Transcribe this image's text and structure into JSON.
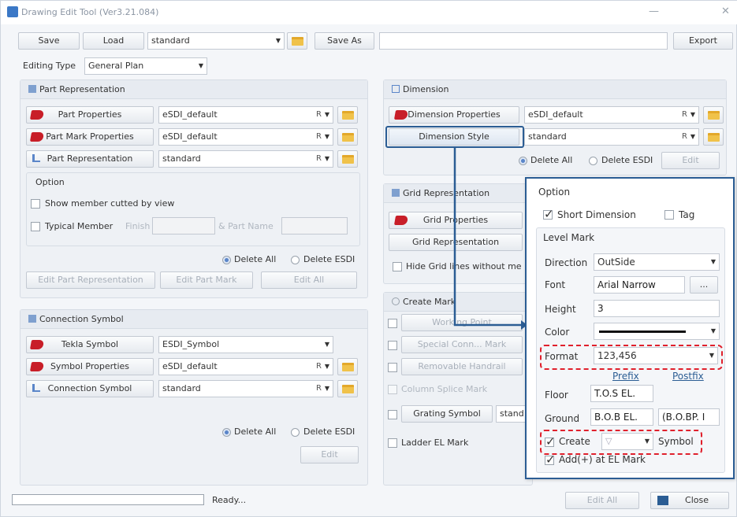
{
  "window": {
    "title": "Drawing Edit Tool (Ver3.21.084)",
    "min": "—",
    "close": "✕"
  },
  "top": {
    "save": "Save",
    "load": "Load",
    "preset": "standard",
    "save_as": "Save As",
    "export": "Export"
  },
  "editing_type": {
    "label": "Editing Type",
    "value": "General Plan"
  },
  "part_rep": {
    "title": "Part Representation",
    "rows": [
      {
        "label": "Part Properties",
        "value": "eSDI_default",
        "r": "R"
      },
      {
        "label": "Part Mark Properties",
        "value": "eSDI_default",
        "r": "R"
      },
      {
        "label": "Part Representation",
        "value": "standard",
        "r": "R"
      }
    ],
    "option": "Option",
    "show_member": "Show member cutted by view",
    "typical_member": "Typical Member",
    "finish": "Finish",
    "part_name": "& Part Name",
    "delete_all": "Delete All",
    "delete_esdi": "Delete ESDI",
    "edit_part_rep": "Edit Part Representation",
    "edit_part_mark": "Edit Part Mark",
    "edit_all": "Edit All"
  },
  "connection": {
    "title": "Connection Symbol",
    "rows": [
      {
        "label": "Tekla Symbol",
        "value": "ESDI_Symbol",
        "r": ""
      },
      {
        "label": "Symbol Properties",
        "value": "eSDI_default",
        "r": "R"
      },
      {
        "label": "Connection Symbol",
        "value": "standard",
        "r": "R"
      }
    ],
    "delete_all": "Delete All",
    "delete_esdi": "Delete ESDI",
    "edit": "Edit"
  },
  "dimension": {
    "title": "Dimension",
    "rows": [
      {
        "label": "Dimension Properties",
        "value": "eSDI_default",
        "r": "R"
      },
      {
        "label": "Dimension Style",
        "value": "standard",
        "r": "R"
      }
    ],
    "delete_all": "Delete All",
    "delete_esdi": "Delete ESDI",
    "edit": "Edit"
  },
  "grid": {
    "title": "Grid Representation",
    "properties": "Grid Properties",
    "representation": "Grid Representation",
    "hide": "Hide Grid lines without me"
  },
  "create_mark": {
    "title": "Create Mark",
    "working_point": "Working Point",
    "special_conn": "Special Conn... Mark",
    "removable": "Removable Handrail",
    "column_splice": "Column Splice Mark",
    "grating": "Grating Symbol",
    "grating_val": "stand",
    "ladder": "Ladder EL Mark"
  },
  "option_panel": {
    "title": "Option",
    "short_dim": "Short Dimension",
    "tag": "Tag",
    "level_mark": "Level Mark",
    "direction_label": "Direction",
    "direction": "OutSide",
    "font_label": "Font",
    "font": "Arial Narrow",
    "font_btn": "...",
    "height_label": "Height",
    "height": "3",
    "color_label": "Color",
    "format_label": "Format",
    "format": "123,456",
    "prefix": "Prefix",
    "postfix": "Postfix",
    "floor_label": "Floor",
    "floor": "T.O.S EL.",
    "ground_label": "Ground",
    "ground": "B.O.B EL.",
    "ground2": "(B.O.BP. I",
    "create": "Create",
    "create_val": "▽",
    "symbol": "Symbol",
    "add": "Add(+) at EL Mark"
  },
  "status": {
    "text": "Ready...",
    "edit_all": "Edit All",
    "close": "Close"
  },
  "colors": {
    "accent": "#2b5d94",
    "highlight": "#e0202c"
  }
}
